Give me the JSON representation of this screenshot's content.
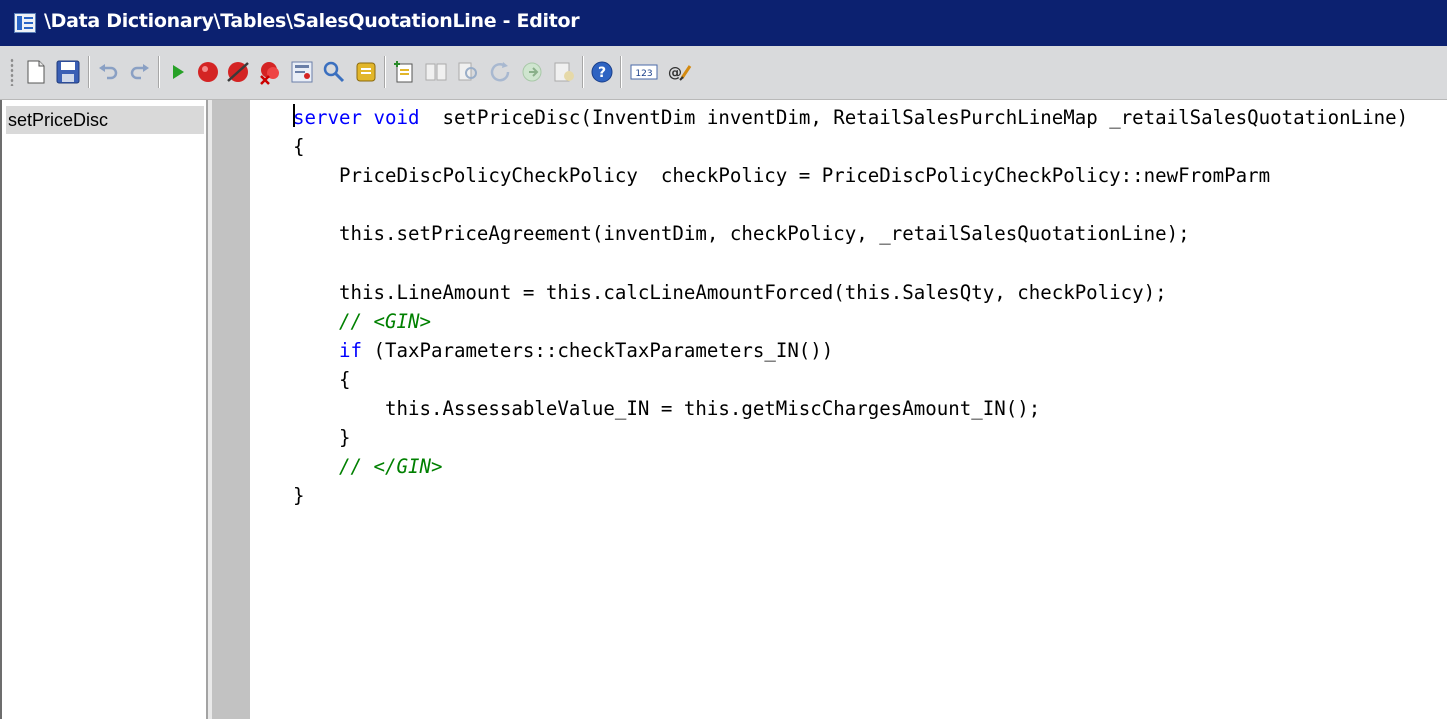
{
  "window": {
    "title": "\\Data Dictionary\\Tables\\SalesQuotationLine - Editor",
    "title_bar_color": "#0c2170"
  },
  "toolbar": {
    "buttons": [
      "new-icon",
      "save-icon",
      "undo-icon",
      "redo-icon",
      "run-icon",
      "breakpoint-icon",
      "enable-breakpoint-icon",
      "remove-breakpoints-icon",
      "list-breakpoints-icon",
      "lookup-icon",
      "script-icon",
      "insert-icon",
      "compare-icon",
      "find-icon",
      "go-back-icon",
      "go-forward-icon",
      "open-icon",
      "help-icon",
      "line-numbers-icon",
      "labels-icon"
    ]
  },
  "method_list": {
    "items": [
      "setPriceDisc"
    ],
    "selected": "setPriceDisc"
  },
  "code": {
    "lines": [
      [
        {
          "t": "server",
          "c": "kw"
        },
        {
          "t": " "
        },
        {
          "t": "void",
          "c": "kw"
        },
        {
          "t": "  setPriceDisc(InventDim inventDim, RetailSalesPurchLineMap _retailSalesQuotationLine)"
        }
      ],
      [
        {
          "t": "{"
        }
      ],
      [
        {
          "t": "    PriceDiscPolicyCheckPolicy  checkPolicy = PriceDiscPolicyCheckPolicy::newFromParm"
        }
      ],
      [
        {
          "t": ""
        }
      ],
      [
        {
          "t": "    this.setPriceAgreement(inventDim, checkPolicy, _retailSalesQuotationLine);"
        }
      ],
      [
        {
          "t": ""
        }
      ],
      [
        {
          "t": "    this.LineAmount = this.calcLineAmountForced(this.SalesQty, checkPolicy);"
        }
      ],
      [
        {
          "t": "    "
        },
        {
          "t": "// <GIN>",
          "c": "cm"
        }
      ],
      [
        {
          "t": "    "
        },
        {
          "t": "if",
          "c": "kw"
        },
        {
          "t": " (TaxParameters::checkTaxParameters_IN())"
        }
      ],
      [
        {
          "t": "    {"
        }
      ],
      [
        {
          "t": "        this.AssessableValue_IN = this.getMiscChargesAmount_IN();"
        }
      ],
      [
        {
          "t": "    }"
        }
      ],
      [
        {
          "t": "    "
        },
        {
          "t": "// </GIN>",
          "c": "cm"
        }
      ],
      [
        {
          "t": "}"
        }
      ]
    ]
  }
}
